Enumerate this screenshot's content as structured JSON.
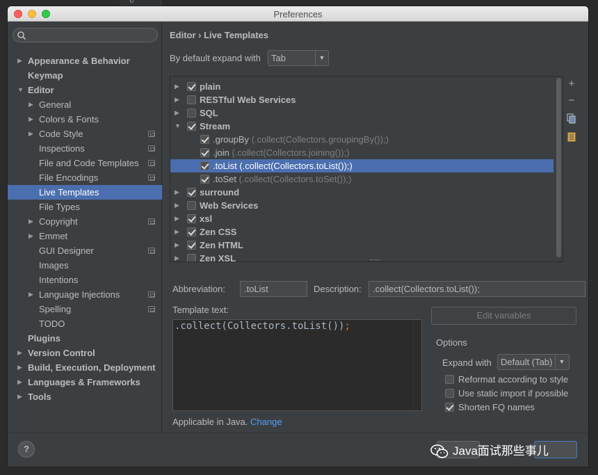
{
  "window": {
    "title": "Preferences"
  },
  "background": {
    "gutter_number": "6"
  },
  "sidebar": {
    "search_placeholder": "",
    "items": [
      {
        "label": "Appearance & Behavior",
        "level": 0,
        "expandable": true,
        "expanded": false,
        "bold": true
      },
      {
        "label": "Keymap",
        "level": 0,
        "expandable": false,
        "bold": true
      },
      {
        "label": "Editor",
        "level": 0,
        "expandable": true,
        "expanded": true,
        "bold": true
      },
      {
        "label": "General",
        "level": 1,
        "expandable": true,
        "expanded": false
      },
      {
        "label": "Colors & Fonts",
        "level": 1,
        "expandable": true,
        "expanded": false
      },
      {
        "label": "Code Style",
        "level": 1,
        "expandable": true,
        "expanded": false,
        "project_icon": true
      },
      {
        "label": "Inspections",
        "level": 1,
        "expandable": false,
        "project_icon": true
      },
      {
        "label": "File and Code Templates",
        "level": 1,
        "expandable": false,
        "project_icon": true
      },
      {
        "label": "File Encodings",
        "level": 1,
        "expandable": false,
        "project_icon": true
      },
      {
        "label": "Live Templates",
        "level": 1,
        "expandable": false,
        "selected": true
      },
      {
        "label": "File Types",
        "level": 1,
        "expandable": false
      },
      {
        "label": "Copyright",
        "level": 1,
        "expandable": true,
        "expanded": false,
        "project_icon": true
      },
      {
        "label": "Emmet",
        "level": 1,
        "expandable": true,
        "expanded": false
      },
      {
        "label": "GUI Designer",
        "level": 1,
        "expandable": false,
        "project_icon": true
      },
      {
        "label": "Images",
        "level": 1,
        "expandable": false
      },
      {
        "label": "Intentions",
        "level": 1,
        "expandable": false
      },
      {
        "label": "Language Injections",
        "level": 1,
        "expandable": true,
        "expanded": false,
        "project_icon": true
      },
      {
        "label": "Spelling",
        "level": 1,
        "expandable": false,
        "project_icon": true
      },
      {
        "label": "TODO",
        "level": 1,
        "expandable": false
      },
      {
        "label": "Plugins",
        "level": 0,
        "expandable": false,
        "bold": true
      },
      {
        "label": "Version Control",
        "level": 0,
        "expandable": true,
        "expanded": false,
        "bold": true
      },
      {
        "label": "Build, Execution, Deployment",
        "level": 0,
        "expandable": true,
        "expanded": false,
        "bold": true
      },
      {
        "label": "Languages & Frameworks",
        "level": 0,
        "expandable": true,
        "expanded": false,
        "bold": true
      },
      {
        "label": "Tools",
        "level": 0,
        "expandable": true,
        "expanded": false,
        "bold": true
      }
    ]
  },
  "main": {
    "breadcrumb": "Editor › Live Templates",
    "expand_label": "By default expand with",
    "expand_value": "Tab",
    "templates": [
      {
        "name": "plain",
        "group": true,
        "checked": true,
        "expanded": false
      },
      {
        "name": "RESTful Web Services",
        "group": true,
        "checked": false,
        "expanded": false
      },
      {
        "name": "SQL",
        "group": true,
        "checked": false,
        "expanded": false
      },
      {
        "name": "Stream",
        "group": true,
        "checked": true,
        "expanded": true
      },
      {
        "name": ".groupBy",
        "desc": "(.collect(Collectors.groupingBy());)",
        "group": false,
        "checked": true
      },
      {
        "name": ".join",
        "desc": "(.collect(Collectors.joining());)",
        "group": false,
        "checked": true
      },
      {
        "name": ".toList",
        "desc": "(.collect(Collectors.toList());)",
        "group": false,
        "checked": true,
        "selected": true
      },
      {
        "name": ".toSet",
        "desc": "(.collect(Collectors.toSet());)",
        "group": false,
        "checked": true
      },
      {
        "name": "surround",
        "group": true,
        "checked": true,
        "expanded": false
      },
      {
        "name": "Web Services",
        "group": true,
        "checked": false,
        "expanded": false
      },
      {
        "name": "xsl",
        "group": true,
        "checked": true,
        "expanded": false
      },
      {
        "name": "Zen CSS",
        "group": true,
        "checked": true,
        "expanded": false
      },
      {
        "name": "Zen HTML",
        "group": true,
        "checked": true,
        "expanded": false
      },
      {
        "name": "Zen XSL",
        "group": true,
        "checked": false,
        "expanded": false
      }
    ],
    "tools": [
      {
        "icon": "plus-icon",
        "glyph": "+"
      },
      {
        "icon": "minus-icon",
        "glyph": "−"
      },
      {
        "icon": "copy-icon",
        "glyph": ""
      },
      {
        "icon": "template-icon",
        "glyph": ""
      }
    ],
    "abbreviation_label": "Abbreviation:",
    "abbreviation_value": ".toList",
    "description_label": "Description:",
    "description_value": ".collect(Collectors.toList());",
    "template_text_label": "Template text:",
    "template_text": ".collect(Collectors.toList())",
    "template_text_end": ";",
    "edit_variables_label": "Edit variables",
    "options_title": "Options",
    "expand_with_label": "Expand with",
    "expand_with_value": "Default (Tab)",
    "options": [
      {
        "label": "Reformat according to style",
        "checked": false
      },
      {
        "label": "Use static import if possible",
        "checked": false
      },
      {
        "label": "Shorten FQ names",
        "checked": true
      }
    ],
    "applicable_text": "Applicable in Java.",
    "change_link": "Change"
  },
  "bottom": {
    "help_glyph": "?",
    "watermark": "Java面试那些事儿"
  },
  "colors": {
    "panel": "#3c3f41",
    "selection": "#4b6eaf",
    "editor_bg": "#2b2b2b",
    "link": "#589df6"
  }
}
